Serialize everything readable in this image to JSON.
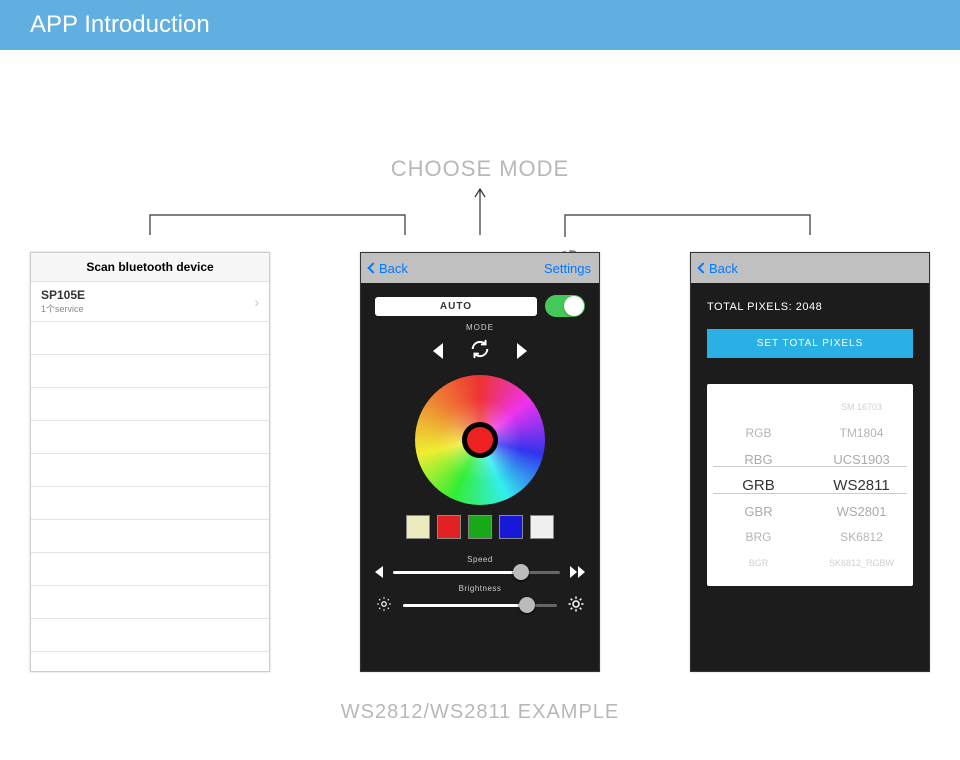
{
  "header": {
    "title": "APP Introduction"
  },
  "labels": {
    "top": "CHOOSE MODE",
    "bottom": "WS2812/WS2811 EXAMPLE"
  },
  "leftPhone": {
    "header": "Scan bluetooth device",
    "device": {
      "name": "SP105E",
      "sub": "1个service",
      "chevron": "›"
    }
  },
  "centerPhone": {
    "nav": {
      "back": "Back",
      "settings": "Settings"
    },
    "auto": "AUTO",
    "modeLabel": "MODE",
    "speedLabel": "Speed",
    "brightnessLabel": "Brightness",
    "swatches": [
      "#ecebbe",
      "#e22222",
      "#18a818",
      "#1818d8",
      "#f0f0f0"
    ]
  },
  "rightPhone": {
    "nav": {
      "back": "Back"
    },
    "totalPixels": "TOTAL PIXELS:  2048",
    "setButton": "SET TOTAL PIXELS",
    "picker": {
      "top": [
        "",
        "SM 16703"
      ],
      "rows": [
        [
          "RGB",
          "TM1804"
        ],
        [
          "RBG",
          "UCS1903"
        ],
        [
          "GRB",
          "WS2811"
        ],
        [
          "GBR",
          "WS2801"
        ],
        [
          "BRG",
          "SK6812"
        ],
        [
          "BGR",
          "SK6812_RGBW"
        ]
      ]
    }
  }
}
